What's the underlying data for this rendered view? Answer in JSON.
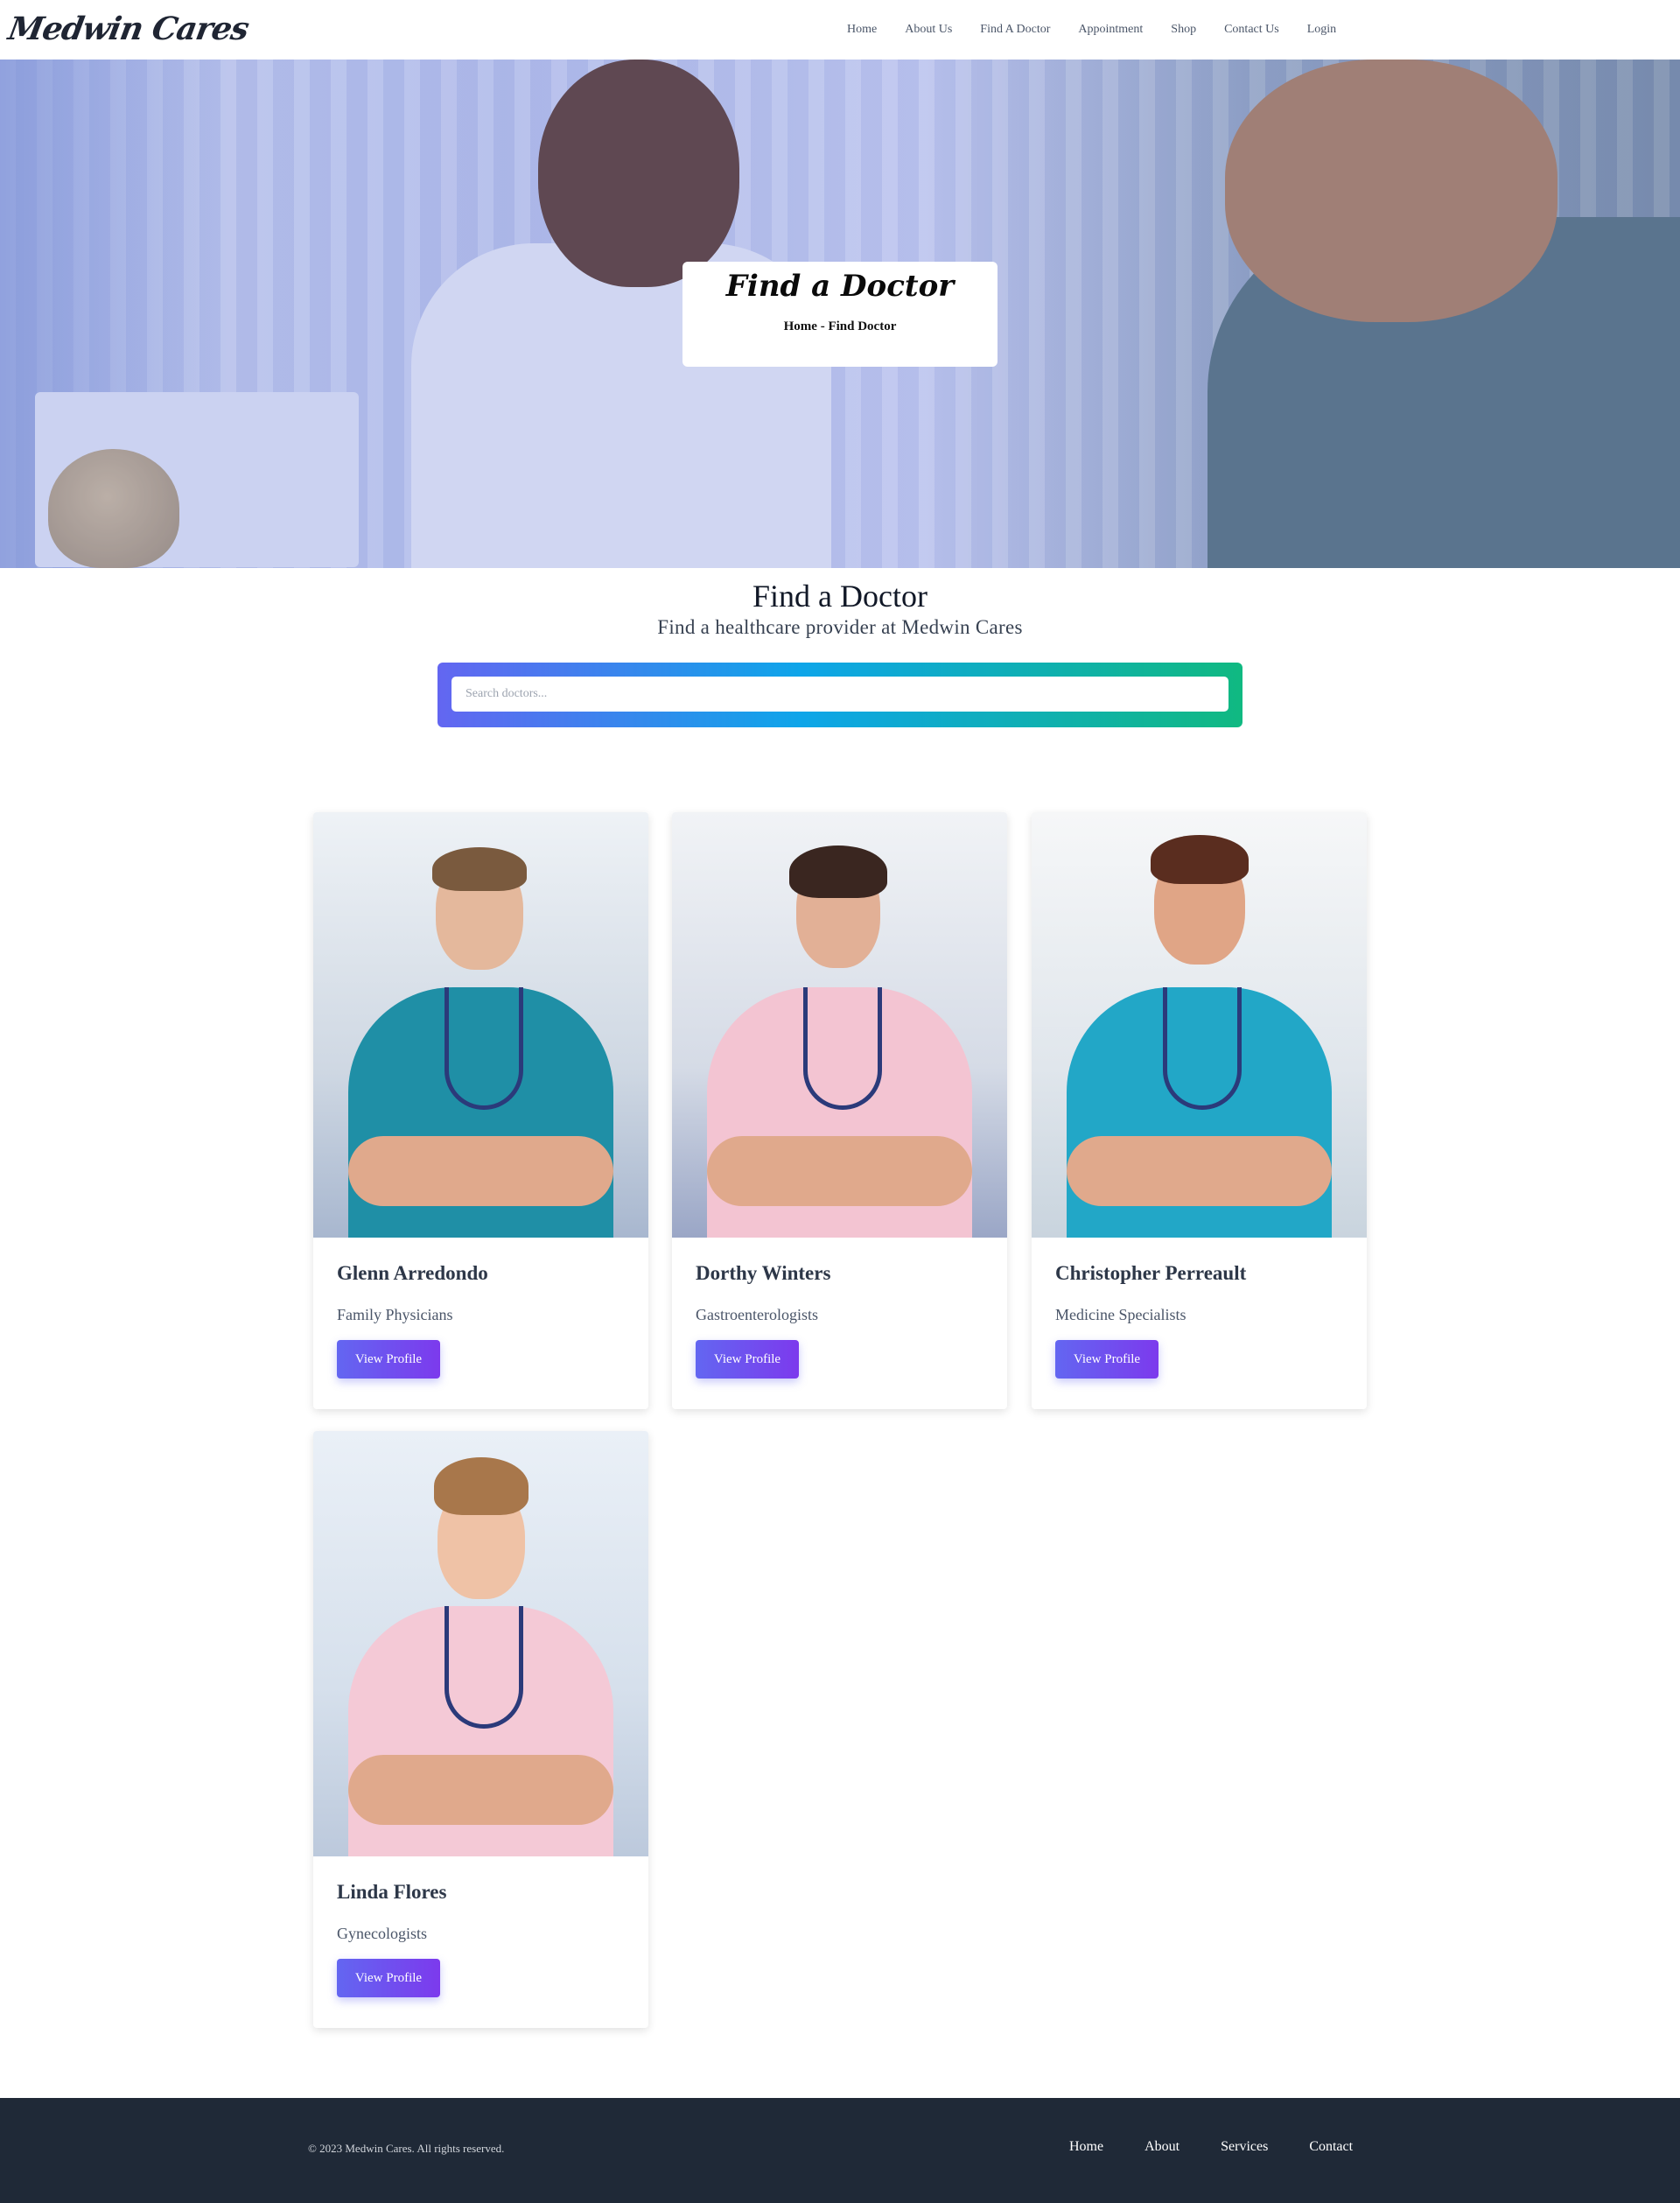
{
  "brand": {
    "logo": "Medwin Cares"
  },
  "nav": {
    "items": [
      "Home",
      "About Us",
      "Find A Doctor",
      "Appointment",
      "Shop",
      "Contact Us",
      "Login"
    ]
  },
  "hero": {
    "title": "Find a Doctor",
    "breadcrumb": "Home - Find Doctor"
  },
  "intro": {
    "heading": "Find a Doctor",
    "subheading": "Find a healthcare provider at Medwin Cares"
  },
  "search": {
    "placeholder": "Search doctors..."
  },
  "doctors": [
    {
      "name": "Glenn Arredondo",
      "specialty": "Family Physicians",
      "button": "View Profile"
    },
    {
      "name": "Dorthy Winters",
      "specialty": "Gastroenterologists",
      "button": "View Profile"
    },
    {
      "name": "Christopher Perreault",
      "specialty": "Medicine Specialists",
      "button": "View Profile"
    },
    {
      "name": "Linda Flores",
      "specialty": "Gynecologists",
      "button": "View Profile"
    }
  ],
  "footer": {
    "copyright": "© 2023 Medwin Cares. All rights reserved.",
    "links": [
      "Home",
      "About",
      "Services",
      "Contact"
    ]
  },
  "colors": {
    "accent_start": "#6366f1",
    "accent_end": "#7c3aed",
    "search_gradient": [
      "#6366f1",
      "#0ea5e9",
      "#10b981"
    ],
    "footer_bg": "#1f2937"
  }
}
